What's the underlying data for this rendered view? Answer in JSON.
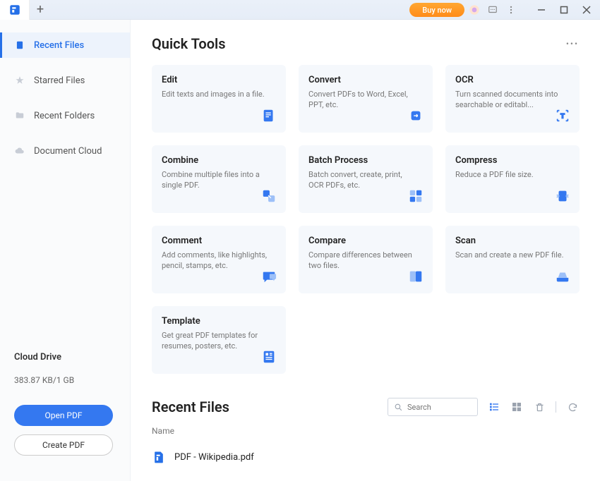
{
  "titlebar": {
    "buy_now": "Buy now"
  },
  "sidebar": {
    "items": [
      {
        "label": "Recent Files"
      },
      {
        "label": "Starred Files"
      },
      {
        "label": "Recent Folders"
      },
      {
        "label": "Document Cloud"
      }
    ],
    "cloud": {
      "title": "Cloud Drive",
      "usage": "383.87 KB/1 GB"
    },
    "open_btn": "Open PDF",
    "create_btn": "Create PDF"
  },
  "quick_tools": {
    "title": "Quick Tools",
    "tools": [
      {
        "title": "Edit",
        "desc": "Edit texts and images in a file."
      },
      {
        "title": "Convert",
        "desc": "Convert PDFs to Word, Excel, PPT, etc."
      },
      {
        "title": "OCR",
        "desc": "Turn scanned documents into searchable or editabl..."
      },
      {
        "title": "Combine",
        "desc": "Combine multiple files into a single PDF."
      },
      {
        "title": "Batch Process",
        "desc": "Batch convert, create, print, OCR PDFs, etc."
      },
      {
        "title": "Compress",
        "desc": "Reduce a PDF file size."
      },
      {
        "title": "Comment",
        "desc": "Add comments, like highlights, pencil, stamps, etc."
      },
      {
        "title": "Compare",
        "desc": "Compare differences between two files."
      },
      {
        "title": "Scan",
        "desc": "Scan and create a new PDF file."
      },
      {
        "title": "Template",
        "desc": "Get great PDF templates for resumes, posters, etc."
      }
    ]
  },
  "recent": {
    "title": "Recent Files",
    "search_placeholder": "Search",
    "col_name": "Name",
    "files": [
      {
        "name": "PDF - Wikipedia.pdf"
      }
    ]
  }
}
